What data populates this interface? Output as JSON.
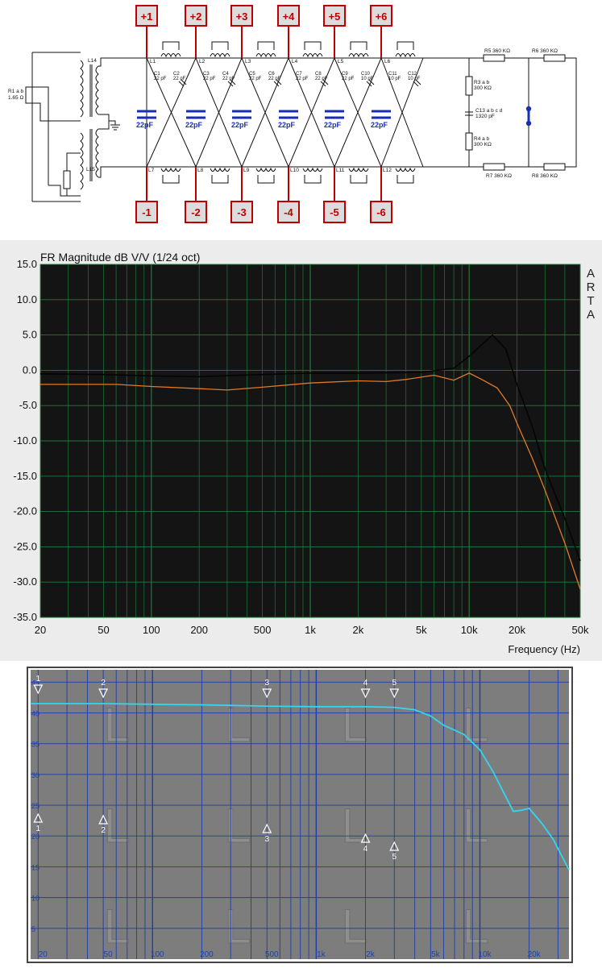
{
  "schematic": {
    "top_tabs": [
      "+1",
      "+2",
      "+3",
      "+4",
      "+5",
      "+6"
    ],
    "bottom_tabs": [
      "-1",
      "-2",
      "-3",
      "-4",
      "-5",
      "-6"
    ],
    "tab_color": "#c00000",
    "tab_fill": "#dcdcdc",
    "top_inductors": [
      "L1",
      "L2",
      "L3",
      "L4",
      "L5",
      "L6"
    ],
    "bottom_inductors": [
      "L7",
      "L8",
      "L9",
      "L10",
      "L11",
      "L12"
    ],
    "caps": [
      {
        "a": "C1",
        "b": "C2",
        "va": "22 pF",
        "vb": "22 pF"
      },
      {
        "a": "C3",
        "b": "C4",
        "va": "22 pF",
        "vb": "22 pF"
      },
      {
        "a": "C5",
        "b": "C6",
        "va": "22 pF",
        "vb": "22 pF"
      },
      {
        "a": "C7",
        "b": "C8",
        "va": "22 pF",
        "vb": "22 pF"
      },
      {
        "a": "C9",
        "b": "C10",
        "va": "22 pF",
        "vb": "10 pF"
      },
      {
        "a": "C11",
        "b": "C12",
        "va": "10 pF",
        "vb": "10 pF"
      }
    ],
    "blue_cap_label": "22pF",
    "blue_color": "#1a2fb0",
    "left_labels": {
      "l14": "L14",
      "l15": "L15",
      "r1a": "R1 a b",
      "r1b": "1.65 Ω"
    },
    "right_labels": {
      "r5": "R5 360 KΩ",
      "r6": "R6 360 KΩ",
      "r7": "R7 360 KΩ",
      "r8": "R8 360 KΩ",
      "r3a": "R3 a b",
      "r3b": "300 KΩ",
      "r4a": "R4 a b",
      "r4b": "300 KΩ",
      "c13a": "C13 a b c d",
      "c13b": "1320 pF"
    }
  },
  "arta": {
    "title": "FR Magnitude dB V/V (1/24 oct)",
    "watermark": [
      "A",
      "R",
      "T",
      "A"
    ],
    "xlabel": "Frequency (Hz)",
    "bg": "#141414",
    "grid": "#1f7a3a",
    "trace_orange": "#e07a2a",
    "trace_dark": "#050505"
  },
  "lp": {
    "bg": "#7d7d7d",
    "grid": "#1d3ea8",
    "trace": "#31d6f0",
    "tick_color": "#1a43b0",
    "watermark_letter": "L",
    "top_markers": [
      "1",
      "2",
      "3",
      "4",
      "5"
    ],
    "bottom_markers": [
      "1",
      "2",
      "3",
      "4",
      "5"
    ]
  },
  "chart_data": [
    {
      "type": "line",
      "title": "FR Magnitude dB V/V (1/24 oct)",
      "xlabel": "Frequency (Hz)",
      "ylabel": "",
      "xscale": "log",
      "xlim": [
        20,
        50000
      ],
      "ylim": [
        -35,
        15
      ],
      "xticks": [
        "20",
        "50",
        "100",
        "200",
        "500",
        "1k",
        "2k",
        "5k",
        "10k",
        "20k",
        "50k"
      ],
      "yticks": [
        "15.0",
        "10.0",
        "5.0",
        "0.0",
        "-5.0",
        "-10.0",
        "-15.0",
        "-20.0",
        "-25.0",
        "-30.0",
        "-35.0"
      ],
      "grid": true,
      "series": [
        {
          "x": [
            20,
            40,
            60,
            100,
            200,
            300,
            500,
            1000,
            2000,
            3000,
            4000,
            6000,
            8000,
            10000,
            12000,
            15000,
            18000,
            20000,
            25000,
            30000,
            40000,
            50000
          ],
          "y": [
            -2.0,
            -2.0,
            -2.0,
            -2.3,
            -2.6,
            -2.8,
            -2.4,
            -1.8,
            -1.5,
            -1.6,
            -1.3,
            -0.7,
            -1.4,
            -0.4,
            -1.3,
            -2.5,
            -5.0,
            -7.5,
            -12.5,
            -17.0,
            -24.5,
            -31.0
          ]
        },
        {
          "x": [
            20,
            50,
            100,
            200,
            500,
            1000,
            2000,
            5000,
            8000,
            10000,
            14000,
            17000,
            20000,
            25000,
            30000,
            40000,
            50000
          ],
          "y": [
            -0.5,
            -0.6,
            -0.8,
            -0.9,
            -0.6,
            -0.4,
            -0.4,
            -0.3,
            0.3,
            2.0,
            5.0,
            3.0,
            -2.0,
            -8.0,
            -14.0,
            -21.0,
            -27.0
          ]
        }
      ]
    },
    {
      "type": "line",
      "xscale": "log",
      "xlim": [
        18,
        35000
      ],
      "ylim": [
        0,
        47
      ],
      "xticks": [
        "20",
        "50",
        "100",
        "200",
        "500",
        "1k",
        "2k",
        "5k",
        "10k",
        "20k"
      ],
      "yticks": [
        "45",
        "40",
        "35",
        "30",
        "25",
        "20",
        "15",
        "10",
        "5"
      ],
      "grid": true,
      "series": [
        {
          "x": [
            18,
            50,
            100,
            200,
            500,
            1000,
            2000,
            3000,
            4000,
            5000,
            6000,
            8000,
            10000,
            12000,
            14000,
            16000,
            18000,
            20000,
            24000,
            28000,
            32000,
            35000
          ],
          "y": [
            41.5,
            41.5,
            41.4,
            41.3,
            41.1,
            41.0,
            41.0,
            40.9,
            40.5,
            39.5,
            38.0,
            36.5,
            34.0,
            30.5,
            27.0,
            24.0,
            24.2,
            24.5,
            22.0,
            19.5,
            16.5,
            14.5
          ]
        }
      ],
      "markers_top": [
        {
          "label": "1",
          "x": 20
        },
        {
          "label": "2",
          "x": 50
        },
        {
          "label": "3",
          "x": 500
        },
        {
          "label": "4",
          "x": 2000
        },
        {
          "label": "5",
          "x": 3000
        }
      ],
      "markers_bottom": [
        {
          "label": "1",
          "x": 20
        },
        {
          "label": "2",
          "x": 50
        },
        {
          "label": "3",
          "x": 500
        },
        {
          "label": "4",
          "x": 2000
        },
        {
          "label": "5",
          "x": 3000
        }
      ]
    }
  ]
}
